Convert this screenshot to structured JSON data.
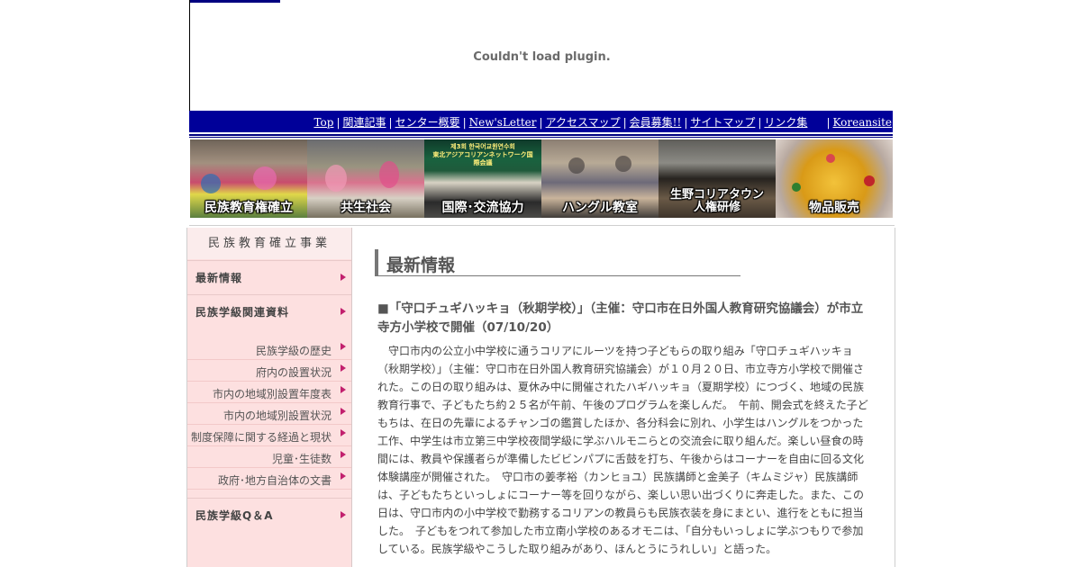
{
  "plugin": {
    "message": "Couldn't load plugin."
  },
  "nav": {
    "items": [
      "Top",
      "関連記事",
      "センター概要",
      "New'sLetter",
      "アクセスマップ",
      "会員募集!!",
      "サイトマップ",
      "リンク集",
      "Koreansite"
    ]
  },
  "banner": {
    "captions": [
      "民族教育権確立",
      "共生社会",
      "国際･交流協力",
      "ハングル教室",
      "生野コリアタウン",
      "人権研修",
      "物品販売"
    ],
    "panel_text": [
      "제3회 한국어교원연수회",
      "東北アジアコリアンネットワーク国際会議"
    ]
  },
  "sidebar": {
    "header": "民族教育確立事業",
    "main_items": [
      "最新情報",
      "民族学級関連資料",
      "民族学級Q＆A"
    ],
    "sub_items": [
      "民族学級の歴史",
      "府内の設置状況",
      "市内の地域別設置年度表",
      "市内の地域別設置状況",
      "制度保障に関する経過と現状",
      "児童･生徒数",
      "政府･地方自治体の文書"
    ]
  },
  "content": {
    "heading": "最新情報",
    "article_title": "■「守口チュギハッキョ（秋期学校）」（主催：守口市在日外国人教育研究協議会）が市立寺方小学校で開催（07/10/20）",
    "article_body": "守口市内の公立小中学校に通うコリアにルーツを持つ子どもらの取り組み「守口チュギハッキョ（秋期学校）」（主催：守口市在日外国人教育研究協議会）が１０月２０日、市立寺方小学校で開催された。この日の取り組みは、夏休み中に開催されたハギハッキョ（夏期学校）につづく、地域の民族教育行事で、子どもたち約２５名が午前、午後のプログラムを楽しんだ。　午前、開会式を終えた子どもちは、在日の先輩によるチャンゴの鑑賞したほか、各分科会に別れ、小学生はハングルをつかった工作、中学生は市立第三中学校夜間学級に学ぶハルモニらとの交流会に取り組んだ。楽しい昼食の時間には、教員や保護者らが準備したビビンパプに舌鼓を打ち、午後からはコーナーを自由に回る文化体験講座が開催された。　守口市の姜孝裕（カンヒョユ）民族講師と金美子（キムミジャ）民族講師は、子どもたちといっしょにコーナー等を回りながら、楽しい思い出づくりに奔走した。また、この日は、守口市内の小中学校で勤務するコリアンの教員らも民族衣装を身にまとい、進行をともに担当した。　子どもをつれて参加した市立南小学校のあるオモニは、「自分もいっしょに学ぶつもりで参加している。民族学級やこうした取り組みがあり、ほんとうにうれしい」と語った。"
  },
  "colors": {
    "nav_bg": "#000099",
    "sidebar_bg": "#fde0e0",
    "arrow": "#c2206e"
  }
}
